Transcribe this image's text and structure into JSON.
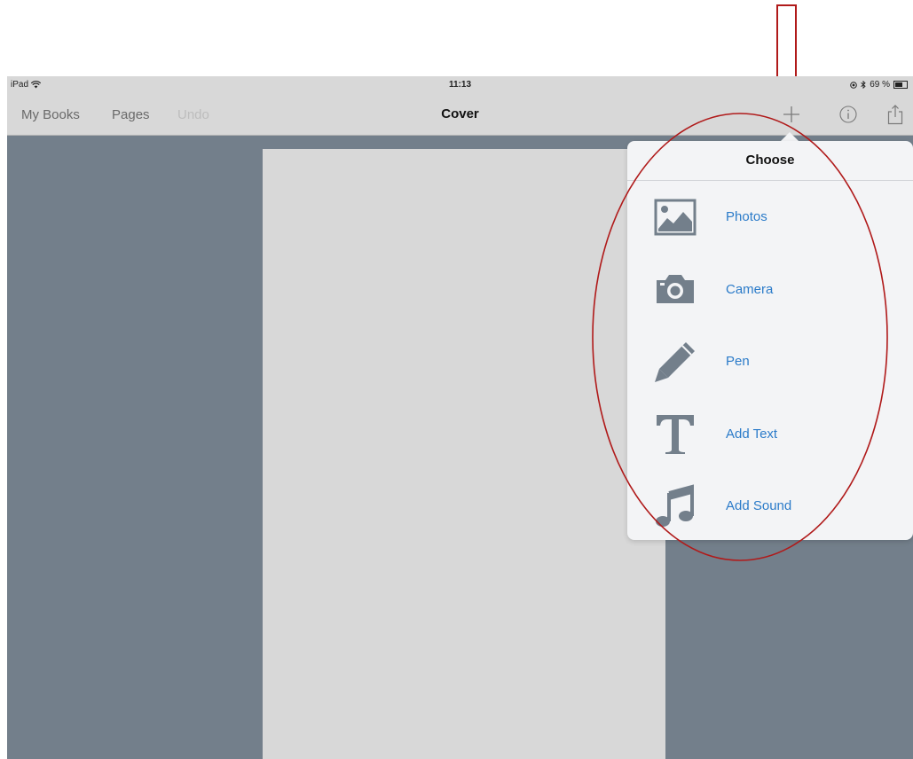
{
  "status_bar": {
    "device": "iPad",
    "time": "11:13",
    "battery": "69 %",
    "battery_level": 0.69
  },
  "nav": {
    "left_buttons": [
      "My Books",
      "Pages",
      "Undo"
    ],
    "title": "Cover",
    "right_icons": [
      "plus-icon",
      "info-icon",
      "share-icon"
    ]
  },
  "popover": {
    "title": "Choose",
    "items": [
      {
        "label": "Photos",
        "icon": "photo-icon"
      },
      {
        "label": "Camera",
        "icon": "camera-icon"
      },
      {
        "label": "Pen",
        "icon": "pen-icon"
      },
      {
        "label": "Add Text",
        "icon": "text-icon"
      },
      {
        "label": "Add Sound",
        "icon": "music-note-icon"
      }
    ]
  },
  "colors": {
    "background": "#737f8b",
    "bar": "#d8d8d8",
    "accent": "#2b7bc9",
    "icon": "#737f8b",
    "annotation": "#b01a1a"
  }
}
